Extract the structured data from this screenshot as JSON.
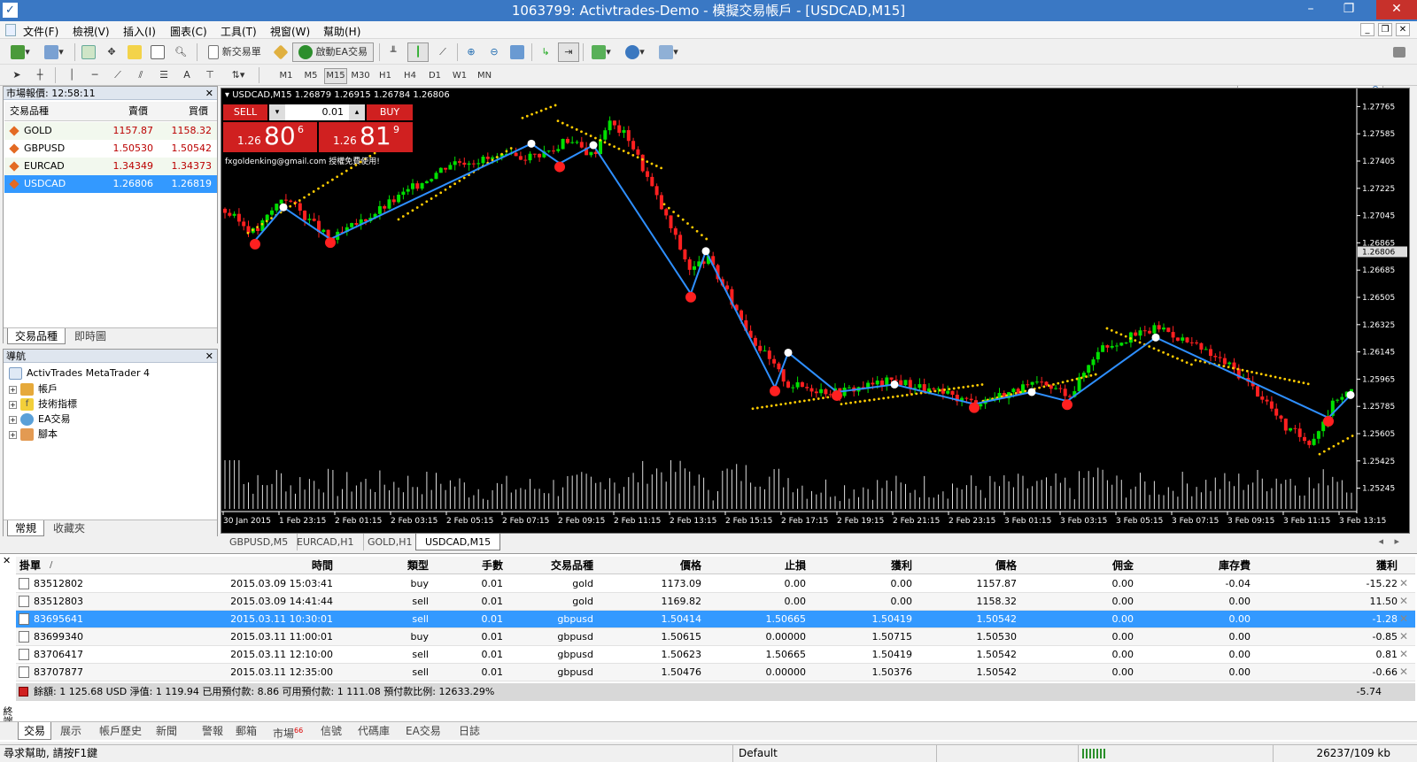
{
  "window": {
    "title": "1063799: Activtrades-Demo - 模擬交易帳戶 - [USDCAD,M15]"
  },
  "menu": [
    "文件(F)",
    "檢視(V)",
    "插入(I)",
    "圖表(C)",
    "工具(T)",
    "視窗(W)",
    "幫助(H)"
  ],
  "toolbar": {
    "new_order": "新交易單",
    "ea_trading": "啟動EA交易"
  },
  "timeframes": [
    "M1",
    "M5",
    "M15",
    "M30",
    "H1",
    "H4",
    "D1",
    "W1",
    "MN"
  ],
  "active_timeframe": "M15",
  "market_watch": {
    "title": "市場報價: 12:58:11",
    "headers": {
      "symbol": "交易品種",
      "bid": "賣價",
      "ask": "買價"
    },
    "rows": [
      {
        "symbol": "GOLD",
        "bid": "1157.87",
        "ask": "1158.32"
      },
      {
        "symbol": "GBPUSD",
        "bid": "1.50530",
        "ask": "1.50542"
      },
      {
        "symbol": "EURCAD",
        "bid": "1.34349",
        "ask": "1.34373"
      },
      {
        "symbol": "USDCAD",
        "bid": "1.26806",
        "ask": "1.26819"
      }
    ],
    "selected_row": 3,
    "tabs": [
      "交易品種",
      "即時圖"
    ]
  },
  "navigator": {
    "title": "導航",
    "root": "ActivTrades MetaTrader 4",
    "items": [
      "帳戶",
      "技術指標",
      "EA交易",
      "腳本"
    ],
    "tabs": [
      "常規",
      "收藏夾"
    ]
  },
  "chart": {
    "info": "USDCAD,M15  1.26879 1.26915 1.26784 1.26806",
    "one_click": {
      "sell": "SELL",
      "buy": "BUY",
      "lot": "0.01",
      "sell_prefix": "1.26",
      "sell_big": "80",
      "sell_sup": "6",
      "buy_prefix": "1.26",
      "buy_big": "81",
      "buy_sup": "9"
    },
    "watermark": "fxgoldenking@gmail.com 授權免費使用!",
    "current_price": "1.26806",
    "price_labels": [
      "1.27765",
      "1.27585",
      "1.27405",
      "1.27225",
      "1.27045",
      "1.26865",
      "1.26685",
      "1.26505",
      "1.26325",
      "1.26145",
      "1.25965",
      "1.25785",
      "1.25605",
      "1.25425",
      "1.25245"
    ],
    "time_labels": [
      "30 Jan 2015",
      "1 Feb 23:15",
      "2 Feb 01:15",
      "2 Feb 03:15",
      "2 Feb 05:15",
      "2 Feb 07:15",
      "2 Feb 09:15",
      "2 Feb 11:15",
      "2 Feb 13:15",
      "2 Feb 15:15",
      "2 Feb 17:15",
      "2 Feb 19:15",
      "2 Feb 21:15",
      "2 Feb 23:15",
      "3 Feb 01:15",
      "3 Feb 03:15",
      "3 Feb 05:15",
      "3 Feb 07:15",
      "3 Feb 09:15",
      "3 Feb 11:15",
      "3 Feb 13:15"
    ],
    "colors": {
      "bull": "#00e000",
      "bear": "#ff2020",
      "zigzag": "#2e8fff",
      "sar": "#ffcc00"
    },
    "tabs": [
      "GBPUSD,M5",
      "EURCAD,H1",
      "GOLD,H1",
      "USDCAD,M15"
    ],
    "active_tab": 3
  },
  "terminal": {
    "headers": {
      "order": "掛單",
      "time": "時間",
      "type": "類型",
      "size": "手數",
      "symbol": "交易品種",
      "price": "價格",
      "sl": "止損",
      "tp": "獲利",
      "price2": "價格",
      "commission": "佣金",
      "swap": "庫存費",
      "profit": "獲利"
    },
    "rows": [
      {
        "order": "83512802",
        "time": "2015.03.09 15:03:41",
        "type": "buy",
        "size": "0.01",
        "symbol": "gold",
        "price": "1173.09",
        "sl": "0.00",
        "tp": "0.00",
        "price2": "1157.87",
        "commission": "0.00",
        "swap": "-0.04",
        "profit": "-15.22"
      },
      {
        "order": "83512803",
        "time": "2015.03.09 14:41:44",
        "type": "sell",
        "size": "0.01",
        "symbol": "gold",
        "price": "1169.82",
        "sl": "0.00",
        "tp": "0.00",
        "price2": "1158.32",
        "commission": "0.00",
        "swap": "0.00",
        "profit": "11.50"
      },
      {
        "order": "83695641",
        "time": "2015.03.11 10:30:01",
        "type": "sell",
        "size": "0.01",
        "symbol": "gbpusd",
        "price": "1.50414",
        "sl": "1.50665",
        "tp": "1.50419",
        "price2": "1.50542",
        "commission": "0.00",
        "swap": "0.00",
        "profit": "-1.28"
      },
      {
        "order": "83699340",
        "time": "2015.03.11 11:00:01",
        "type": "buy",
        "size": "0.01",
        "symbol": "gbpusd",
        "price": "1.50615",
        "sl": "0.00000",
        "tp": "1.50715",
        "price2": "1.50530",
        "commission": "0.00",
        "swap": "0.00",
        "profit": "-0.85"
      },
      {
        "order": "83706417",
        "time": "2015.03.11 12:10:00",
        "type": "sell",
        "size": "0.01",
        "symbol": "gbpusd",
        "price": "1.50623",
        "sl": "1.50665",
        "tp": "1.50419",
        "price2": "1.50542",
        "commission": "0.00",
        "swap": "0.00",
        "profit": "0.81"
      },
      {
        "order": "83707877",
        "time": "2015.03.11 12:35:00",
        "type": "sell",
        "size": "0.01",
        "symbol": "gbpusd",
        "price": "1.50476",
        "sl": "0.00000",
        "tp": "1.50376",
        "price2": "1.50542",
        "commission": "0.00",
        "swap": "0.00",
        "profit": "-0.66"
      }
    ],
    "selected_row": 2,
    "summary": "餘額: 1 125.68 USD  淨值: 1 119.94  已用預付款: 8.86  可用預付款: 1 111.08  預付款比例: 12633.29%",
    "summary_profit": "-5.74",
    "side_label": "終端",
    "tabs": [
      "交易",
      "展示",
      "帳戶歷史",
      "新聞",
      "警報",
      "郵箱",
      "市場",
      "信號",
      "代碼庫",
      "EA交易",
      "日誌"
    ],
    "market_badge": "66"
  },
  "statusbar": {
    "help": "尋求幫助, 請按F1鍵",
    "profile": "Default",
    "traffic": "26237/109 kb"
  }
}
